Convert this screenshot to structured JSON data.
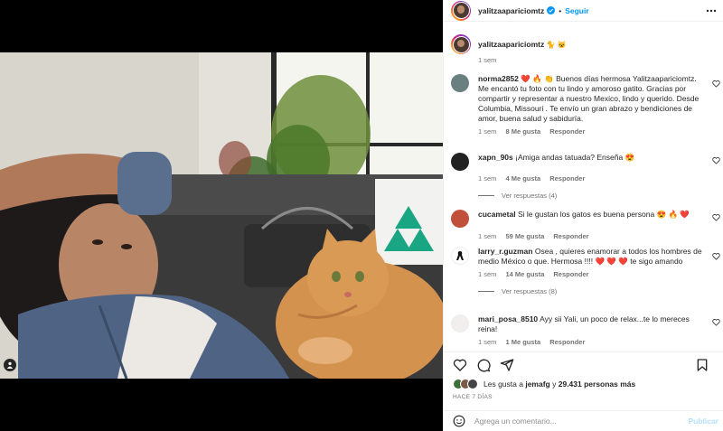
{
  "colors": {
    "accent": "#0095f6",
    "text": "#262626",
    "muted": "#737373",
    "heart": "#ed4956"
  },
  "header": {
    "username": "yalitzaapariciomtz",
    "verified_icon": "verified-badge-icon",
    "separator": "•",
    "follow_label": "Seguir",
    "more_icon": "more-dots-icon"
  },
  "caption": {
    "username": "yalitzaapariciomtz",
    "emojis": "🐈 😺",
    "time": "1 sem"
  },
  "comments": [
    {
      "username": "norma2852",
      "text": "❤️ 🔥 👏 Buenos días hermosa Yalitzaapariciomtz. Me encantó tu foto con tu lindo y amoroso gatito. Gracias por compartir y representar a nuestro Mexico, lindo y querido. Desde Columbia, Missouri . Te envío un gran abrazo y bendiciones de amor, buena salud y sabiduría.",
      "time": "1 sem",
      "likes": "8 Me gusta",
      "reply": "Responder"
    },
    {
      "username": "xapn_90s",
      "text": "¡Amiga andas tatuada? Enseña 😍",
      "time": "1 sem",
      "likes": "4 Me gusta",
      "reply": "Responder",
      "view_replies": "Ver respuestas (4)"
    },
    {
      "username": "cucametal",
      "text": "Si le gustan los gatos es buena persona 😍 🔥 ❤️",
      "time": "1 sem",
      "likes": "59 Me gusta",
      "reply": "Responder"
    },
    {
      "username": "larry_r.guzman",
      "text": "Osea , quieres enamorar a todos los hombres de medio México o que. Hermosa !!!! ❤️ ❤️ ❤️ te sigo amando",
      "time": "1 sem",
      "likes": "14 Me gusta",
      "reply": "Responder",
      "view_replies": "Ver respuestas (8)"
    },
    {
      "username": "mari_posa_8510",
      "text": "Ayy sii Yali, un poco de relax...te lo mereces reina!",
      "time": "1 sem",
      "likes": "1 Me gusta",
      "reply": "Responder"
    }
  ],
  "actions": {
    "like_icon": "heart-icon",
    "comment_icon": "comment-icon",
    "share_icon": "share-icon",
    "save_icon": "bookmark-icon"
  },
  "likes": {
    "prefix": "Les gusta a",
    "user": "jemafg",
    "middle": "y",
    "count": "29.431 personas más"
  },
  "date": "HACE 7 DÍAS",
  "add_comment": {
    "placeholder": "Agrega un comentario...",
    "post_label": "Publicar",
    "emoji_icon": "smiley-icon"
  },
  "media": {
    "tag_icon": "user-tag-icon"
  }
}
